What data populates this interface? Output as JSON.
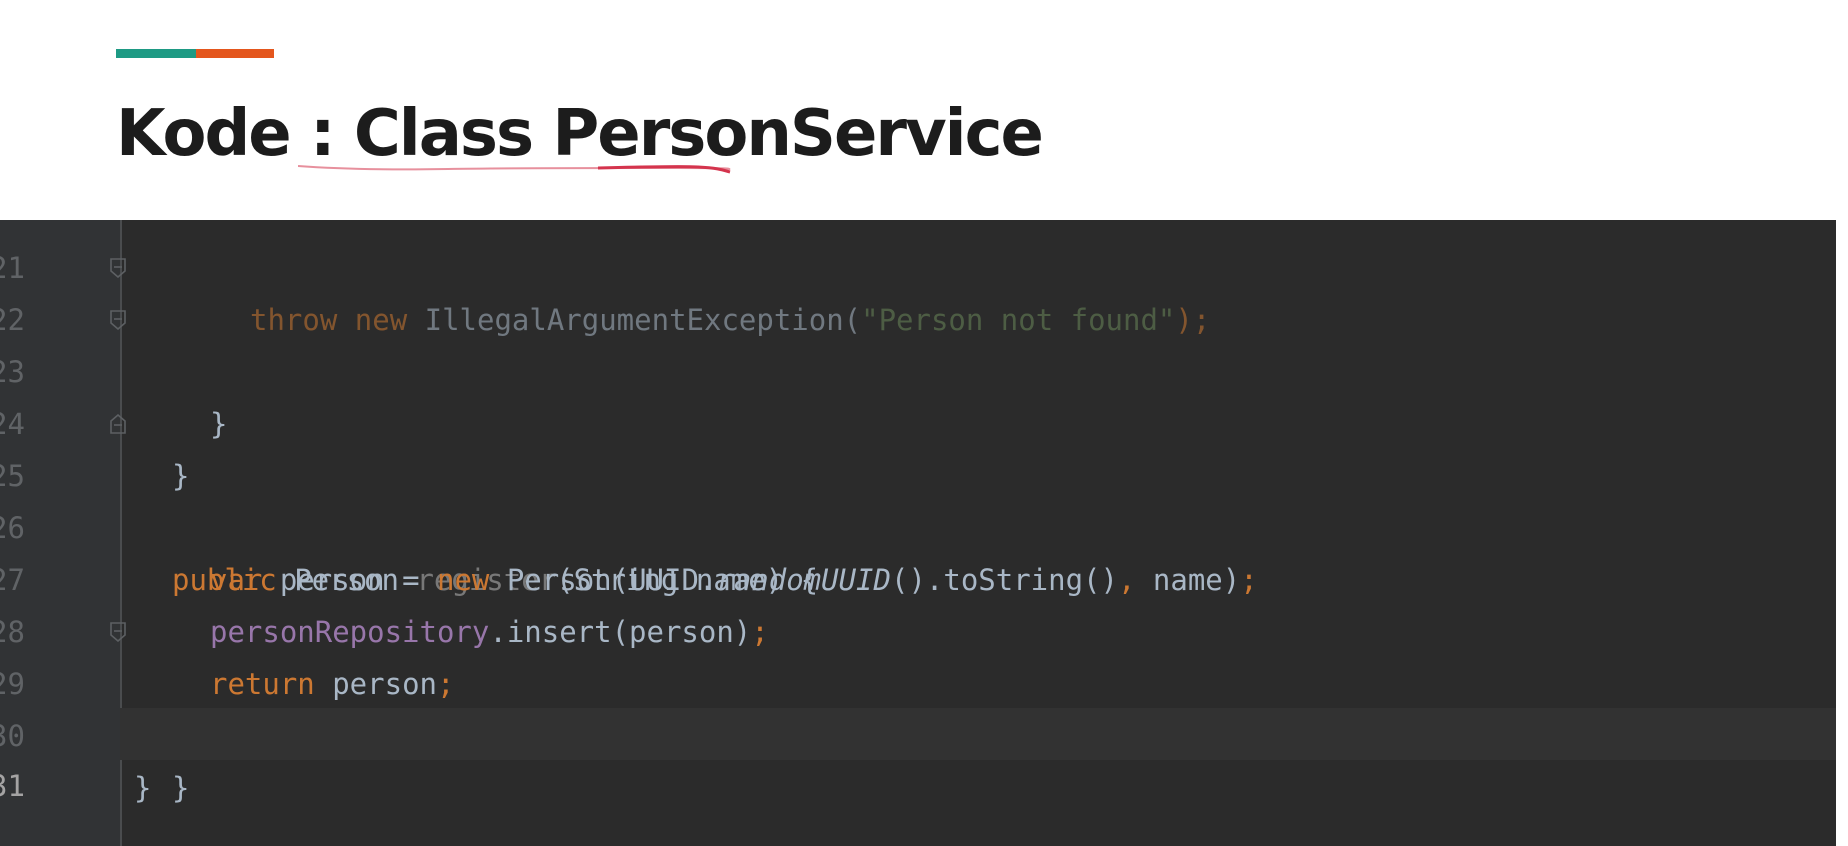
{
  "colors": {
    "accent_teal": "#1e9a84",
    "accent_orange": "#e4561d",
    "editor_bg": "#2b2b2b",
    "keyword": "#cc7832",
    "plain": "#a9b7c6",
    "field": "#9876aa",
    "string": "#6a8759",
    "squiggle": "#d4344d"
  },
  "slide": {
    "title": "Kode : Class PersonService"
  },
  "editor": {
    "lines": [
      {
        "number": "21",
        "fold_marker": false,
        "tokens": [
          {
            "text": "throw",
            "kind": "keyword"
          },
          {
            "text": " ",
            "kind": "plain"
          },
          {
            "text": "new",
            "kind": "keyword"
          },
          {
            "text": " IllegalArgumentException(",
            "kind": "plain"
          },
          {
            "text": "\"Person not found\"",
            "kind": "string"
          },
          {
            "text": ");",
            "kind": "keyword"
          }
        ]
      },
      {
        "number": "22",
        "fold_marker": true,
        "tokens": [
          {
            "text": "}",
            "kind": "plain"
          }
        ]
      },
      {
        "number": "23",
        "fold_marker": true,
        "tokens": [
          {
            "text": "}",
            "kind": "plain"
          }
        ]
      },
      {
        "number": "24",
        "fold_marker": false,
        "tokens": []
      },
      {
        "number": "25",
        "fold_marker": true,
        "tokens": [
          {
            "text": "public",
            "kind": "keyword"
          },
          {
            "text": " Person ",
            "kind": "plain"
          },
          {
            "text": "register",
            "kind": "dim"
          },
          {
            "text": "(String name) {",
            "kind": "plain"
          }
        ]
      },
      {
        "number": "26",
        "fold_marker": false,
        "tokens": [
          {
            "text": "var",
            "kind": "keyword"
          },
          {
            "text": " person = ",
            "kind": "plain"
          },
          {
            "text": "new",
            "kind": "keyword"
          },
          {
            "text": " Person(UUID.",
            "kind": "plain"
          },
          {
            "text": "randomUUID",
            "kind": "italic"
          },
          {
            "text": "().toString()",
            "kind": "plain"
          },
          {
            "text": ",",
            "kind": "keyword"
          },
          {
            "text": " name)",
            "kind": "plain"
          },
          {
            "text": ";",
            "kind": "keyword"
          }
        ]
      },
      {
        "number": "27",
        "fold_marker": false,
        "tokens": [
          {
            "text": "personRepository",
            "kind": "field"
          },
          {
            "text": ".insert(person)",
            "kind": "plain"
          },
          {
            "text": ";",
            "kind": "keyword"
          }
        ]
      },
      {
        "number": "28",
        "fold_marker": false,
        "tokens": [
          {
            "text": "return",
            "kind": "keyword"
          },
          {
            "text": " person",
            "kind": "plain"
          },
          {
            "text": ";",
            "kind": "keyword"
          }
        ]
      },
      {
        "number": "29",
        "fold_marker": true,
        "tokens": [
          {
            "text": "}",
            "kind": "plain"
          }
        ]
      },
      {
        "number": "30",
        "fold_marker": false,
        "tokens": [
          {
            "text": "}",
            "kind": "plain"
          }
        ]
      },
      {
        "number": "31",
        "fold_marker": false,
        "tokens": []
      }
    ]
  }
}
